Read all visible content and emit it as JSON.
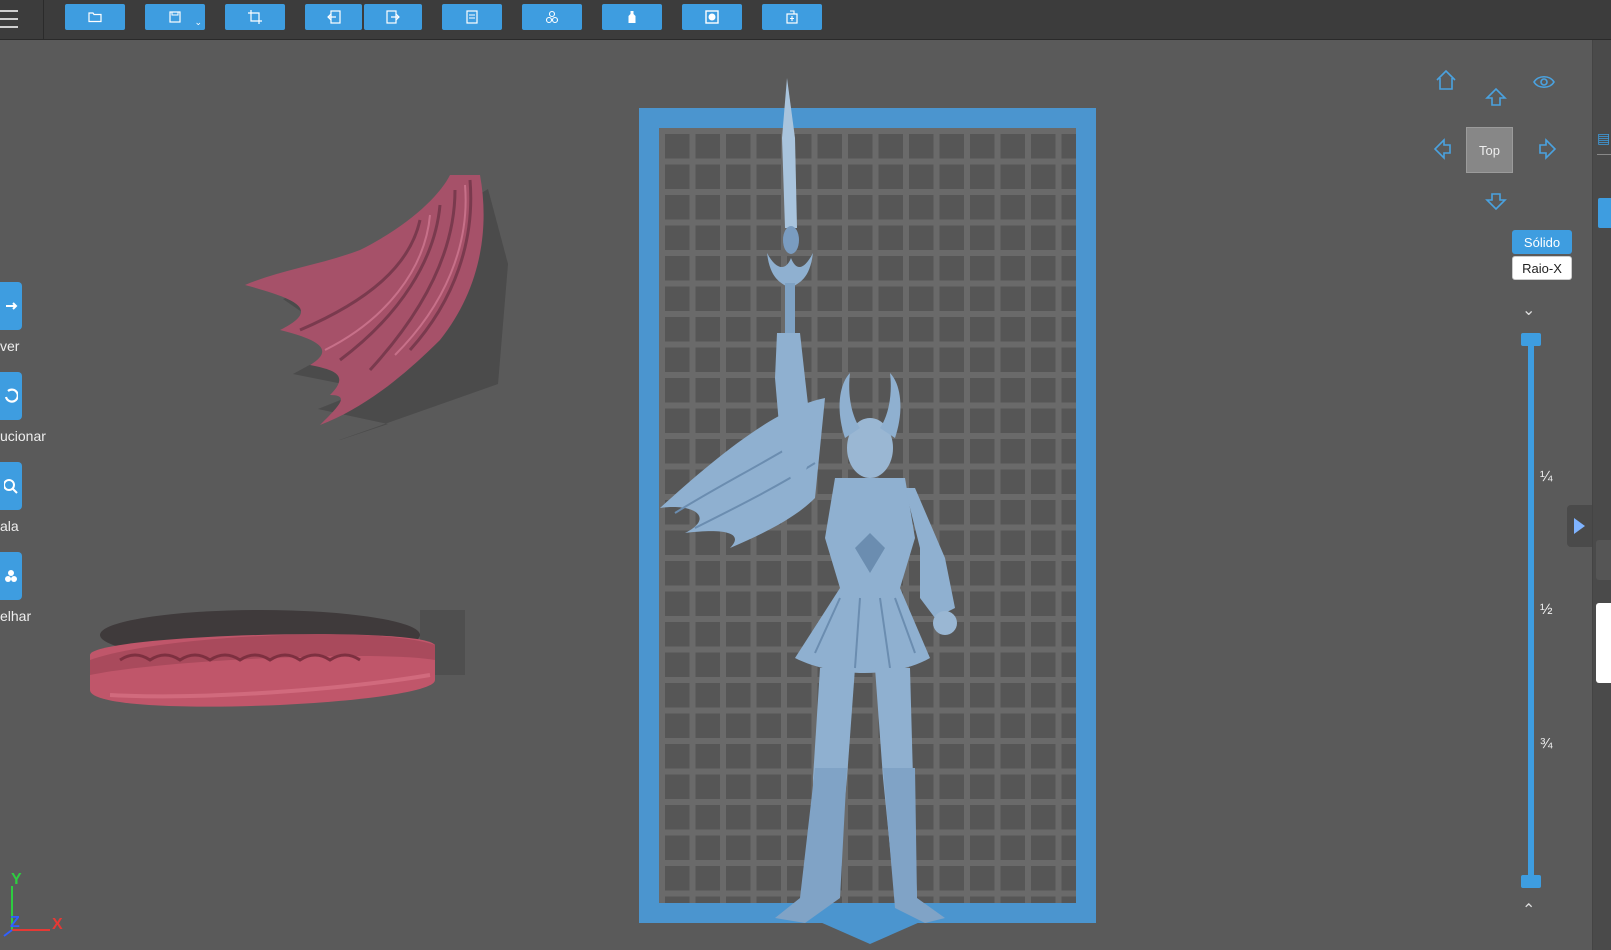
{
  "toolbar": {
    "items": [
      {
        "name": "open-file",
        "icon": "folder-icon"
      },
      {
        "name": "save",
        "icon": "save-icon",
        "has_dropdown": true
      },
      {
        "name": "crop",
        "icon": "crop-icon"
      },
      {
        "name": "import",
        "icon": "import-icon"
      },
      {
        "name": "export",
        "icon": "export-icon"
      },
      {
        "name": "document",
        "icon": "document-icon"
      },
      {
        "name": "supports",
        "icon": "supports-icon"
      },
      {
        "name": "bottle",
        "icon": "bottle-icon"
      },
      {
        "name": "frame",
        "icon": "frame-icon"
      },
      {
        "name": "print",
        "icon": "print-icon"
      }
    ]
  },
  "left_tools": [
    {
      "label": "ver",
      "icon": "move-icon"
    },
    {
      "label": "ucionar",
      "icon": "rotate-icon"
    },
    {
      "label": "ala",
      "icon": "scale-icon"
    },
    {
      "label": "elhar",
      "icon": "mirror-icon"
    }
  ],
  "view": {
    "face_label": "Top",
    "mode_solid": "Sólido",
    "mode_xray": "Raio-X",
    "active_mode": "Sólido"
  },
  "slider": {
    "marks": [
      "¼",
      "½",
      "¾"
    ],
    "upper_value": 1.0,
    "lower_value": 0.0
  },
  "axis": {
    "x": "X",
    "y": "Y",
    "z": "Z"
  },
  "colors": {
    "accent": "#3e9de0",
    "model_figure": "#8fb0d0",
    "model_cape": "#b25a73",
    "model_base": "#c0566a",
    "plate": "#4b95cf"
  }
}
